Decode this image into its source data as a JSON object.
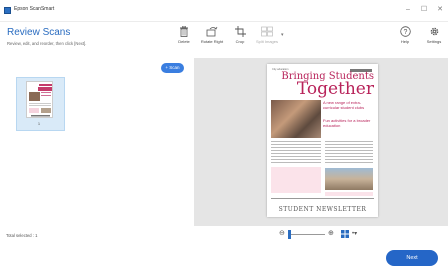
{
  "window": {
    "title": "Epson ScanSmart",
    "controls": {
      "minimize": "–",
      "maximize": "☐",
      "close": "✕"
    }
  },
  "header": {
    "title": "Review Scans",
    "subtitle": "Review, edit, and reorder, then click [Next]."
  },
  "toolbar": {
    "delete_label": "Delete",
    "rotate_label": "Rotate Right",
    "crop_label": "Crop",
    "split_label": "Split Images",
    "help_label": "Help",
    "settings_label": "Settings"
  },
  "left_pane": {
    "scan_button": "+ Scan",
    "thumbnail_page_number": "1",
    "total_selected": "Total selected : 1"
  },
  "document": {
    "header_small": "City education",
    "title_line1": "Bringing Students",
    "title_line2": "Together",
    "sub1": "A new range of extra-curricular student clubs",
    "sub2": "Fun activities for a broader education",
    "footer": "STUDENT NEWSLETTER"
  },
  "footer": {
    "next_label": "Next"
  },
  "colors": {
    "accent": "#2566c7",
    "title_blue": "#2a6cc0",
    "newsletter_pink": "#b8235a"
  }
}
